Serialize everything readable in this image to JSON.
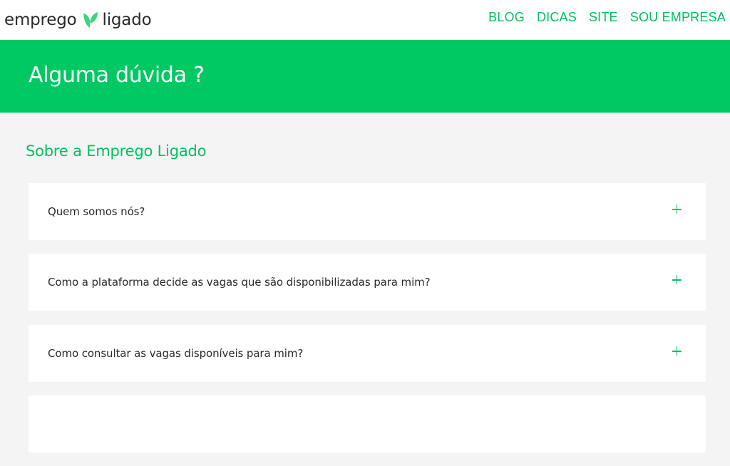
{
  "header": {
    "logo_left": "emprego",
    "logo_right": "ligado",
    "nav": [
      "BLOG",
      "DICAS",
      "SITE",
      "SOU EMPRESA"
    ]
  },
  "hero": {
    "title": "Alguma dúvida ?"
  },
  "section": {
    "title": "Sobre a Emprego Ligado"
  },
  "faq": [
    {
      "question": "Quem somos nós?"
    },
    {
      "question": "Como a plataforma decide as vagas que são disponibilizadas para mim?"
    },
    {
      "question": "Como consultar as vagas disponíveis para mim?"
    },
    {
      "question": ""
    }
  ],
  "colors": {
    "brand_green": "#00c963",
    "link_green": "#00c060",
    "background": "#f4f4f4"
  }
}
